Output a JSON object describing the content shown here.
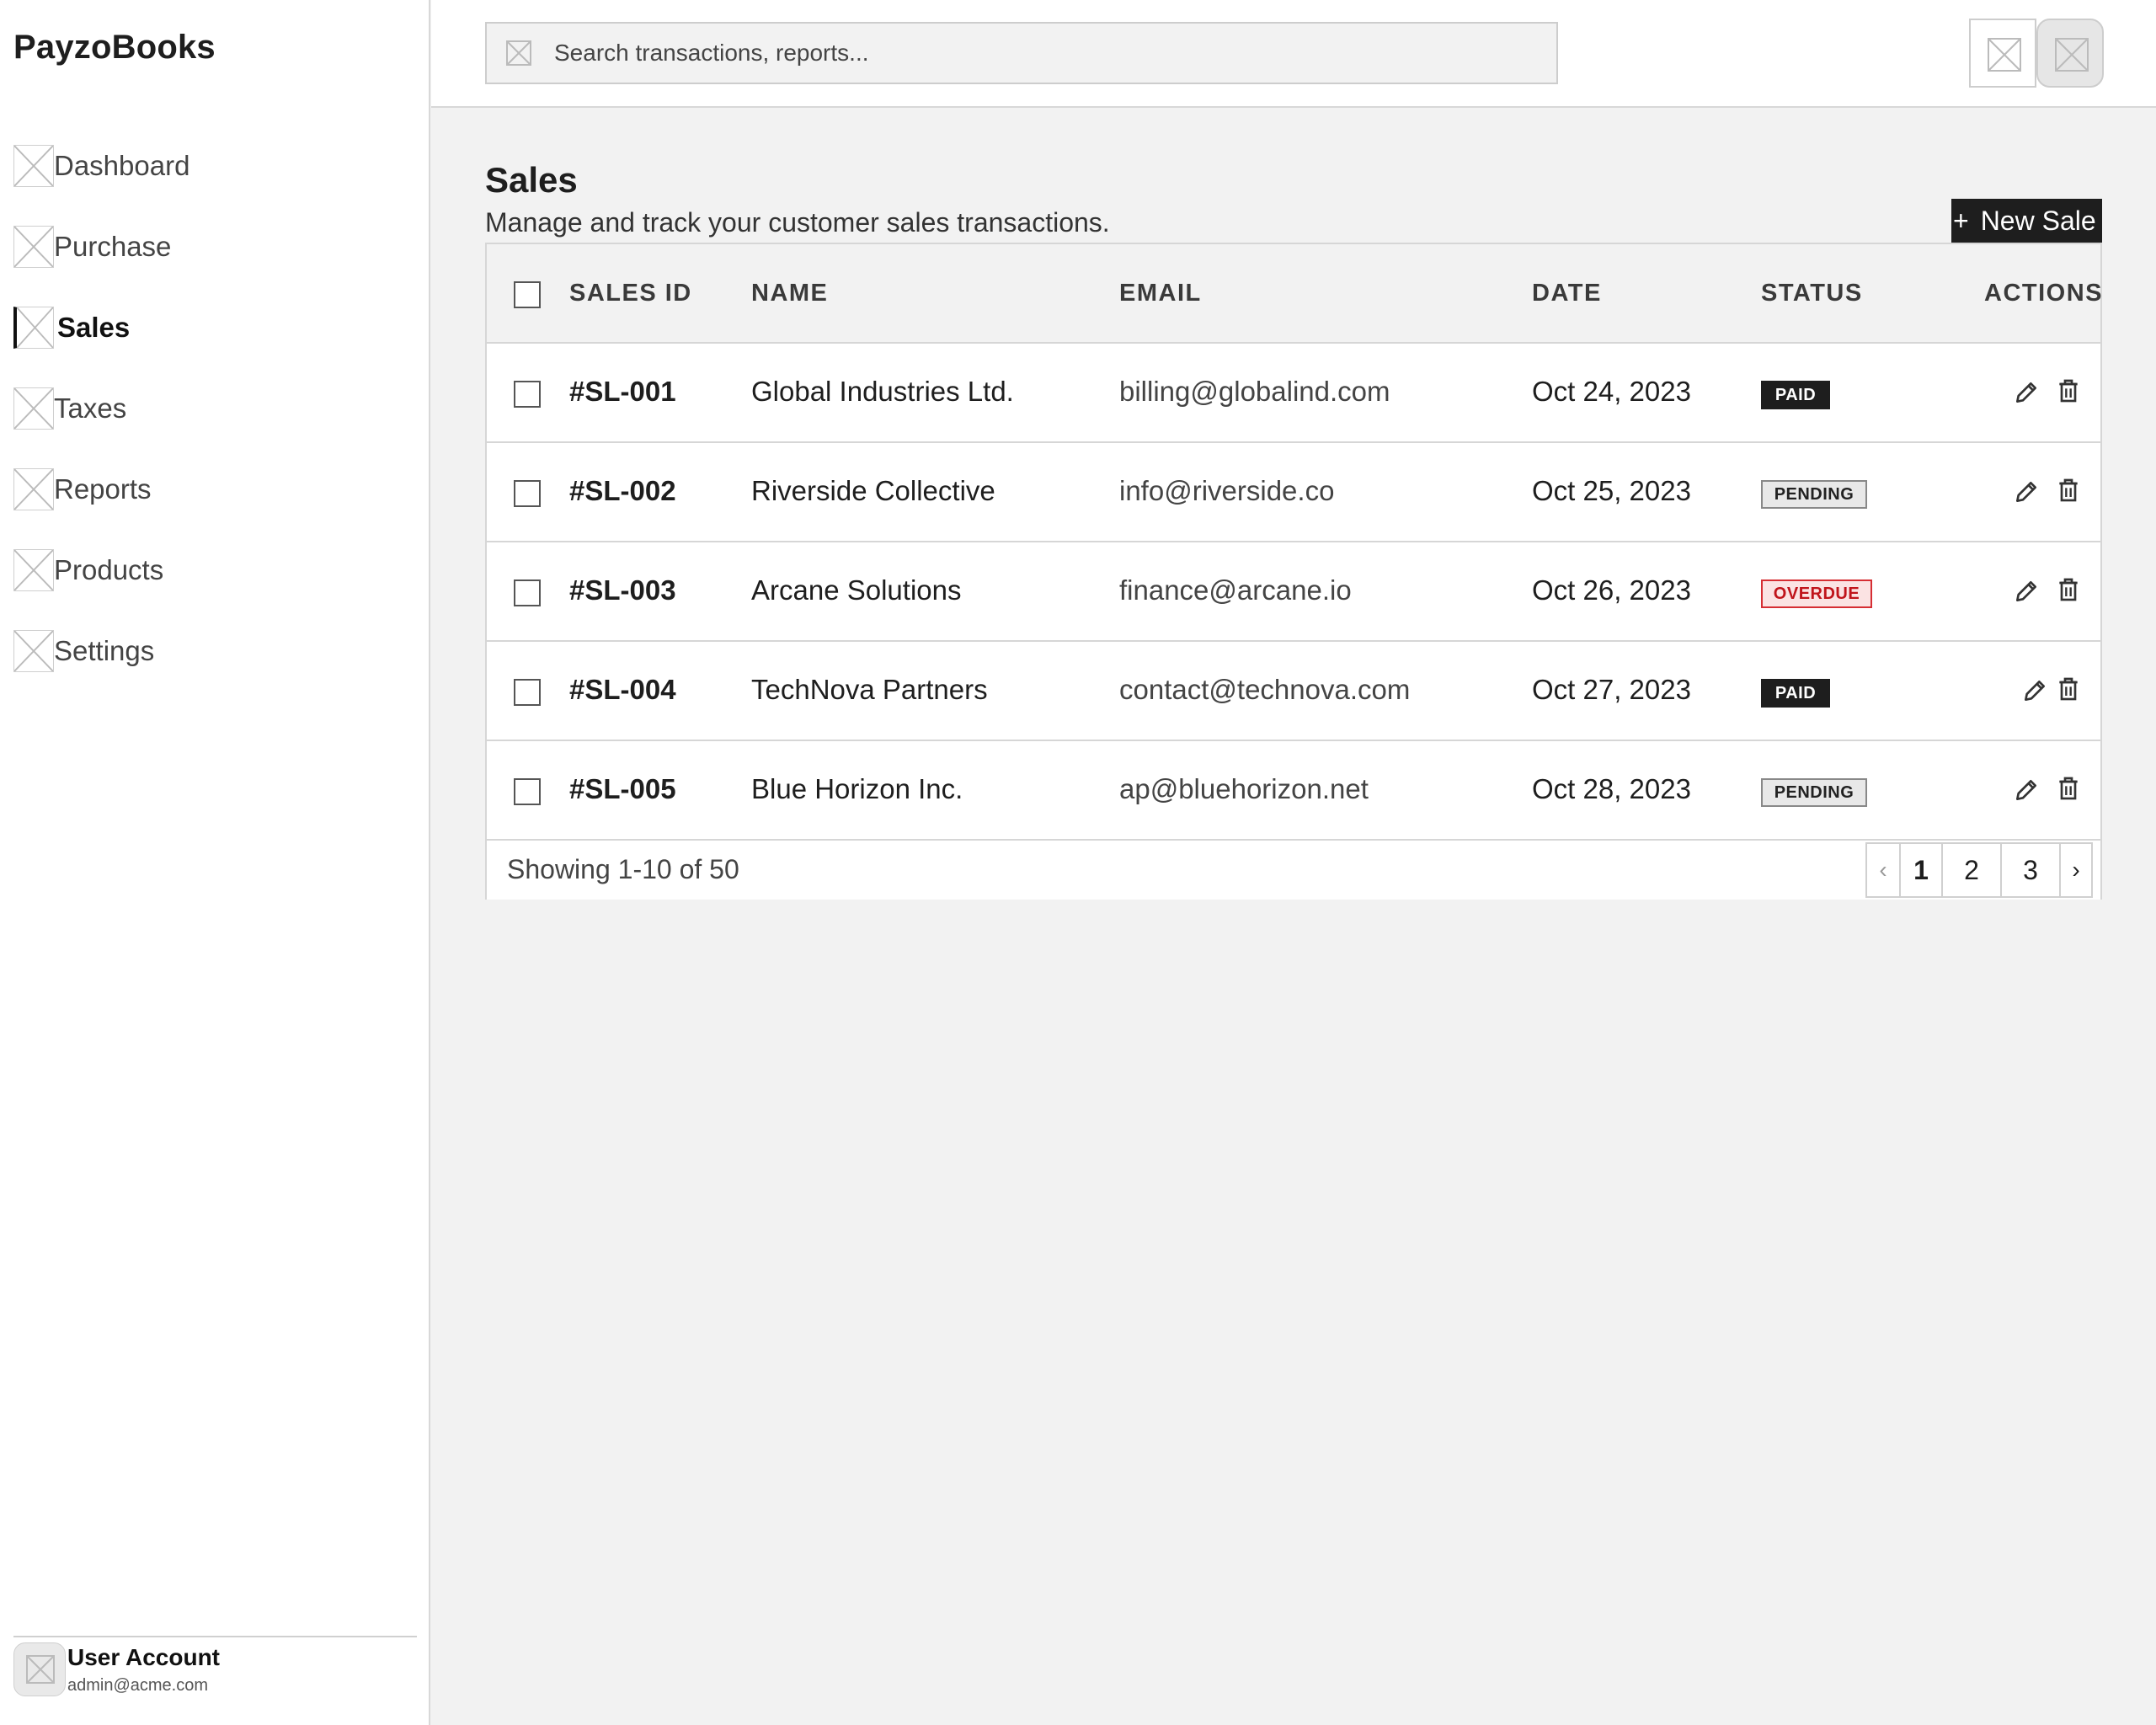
{
  "app": {
    "brand": "PayzoBooks"
  },
  "sidebar": {
    "items": [
      {
        "label": "Dashboard",
        "icon": "dashboard-icon",
        "active": false
      },
      {
        "label": "Purchase",
        "icon": "purchase-icon",
        "active": false
      },
      {
        "label": "Sales",
        "icon": "sales-icon",
        "active": true
      },
      {
        "label": "Taxes",
        "icon": "taxes-icon",
        "active": false
      },
      {
        "label": "Reports",
        "icon": "reports-icon",
        "active": false
      },
      {
        "label": "Products",
        "icon": "products-icon",
        "active": false
      },
      {
        "label": "Settings",
        "icon": "settings-icon",
        "active": false
      }
    ],
    "user": {
      "name": "User Account",
      "email": "admin@acme.com",
      "icon": "avatar-icon"
    }
  },
  "topbar": {
    "search": {
      "placeholder": "Search transactions, reports...",
      "value": "",
      "icon": "search-icon"
    },
    "buttons": [
      {
        "icon": "notification-icon"
      },
      {
        "icon": "profile-icon"
      }
    ]
  },
  "main": {
    "title": "Sales",
    "subtitle": "Manage and track your customer sales transactions.",
    "new_button": {
      "plus": "+",
      "label": "New Sale"
    },
    "table": {
      "headers": {
        "id": "SALES ID",
        "name": "NAME",
        "email": "EMAIL",
        "date": "DATE",
        "status": "STATUS",
        "actions": "ACTIONS"
      },
      "rows": [
        {
          "id": "#SL-001",
          "name": "Global Industries Ltd.",
          "email": "billing@globalind.com",
          "date": "Oct 24, 2023",
          "status": "PAID",
          "status_type": "paid"
        },
        {
          "id": "#SL-002",
          "name": "Riverside Collective",
          "email": "info@riverside.co",
          "date": "Oct 25, 2023",
          "status": "PENDING",
          "status_type": "pending"
        },
        {
          "id": "#SL-003",
          "name": "Arcane Solutions",
          "email": "finance@arcane.io",
          "date": "Oct 26, 2023",
          "status": "OVERDUE",
          "status_type": "overdue"
        },
        {
          "id": "#SL-004",
          "name": "TechNova Partners",
          "email": "contact@technova.com",
          "date": "Oct 27, 2023",
          "status": "PAID",
          "status_type": "paid"
        },
        {
          "id": "#SL-005",
          "name": "Blue Horizon Inc.",
          "email": "ap@bluehorizon.net",
          "date": "Oct 28, 2023",
          "status": "PENDING",
          "status_type": "pending"
        }
      ],
      "footer": {
        "showing": "Showing 1-10 of 50",
        "pagination": {
          "prev": "‹",
          "pages": [
            "1",
            "2",
            "3"
          ],
          "current": "1",
          "next": "›"
        }
      }
    }
  },
  "colors": {
    "dark": "#1e1e1e",
    "overdue": "#c0141b",
    "overdue_bg": "#fbe3e3",
    "border": "#d6d6d6",
    "background": "#f2f2f2"
  }
}
